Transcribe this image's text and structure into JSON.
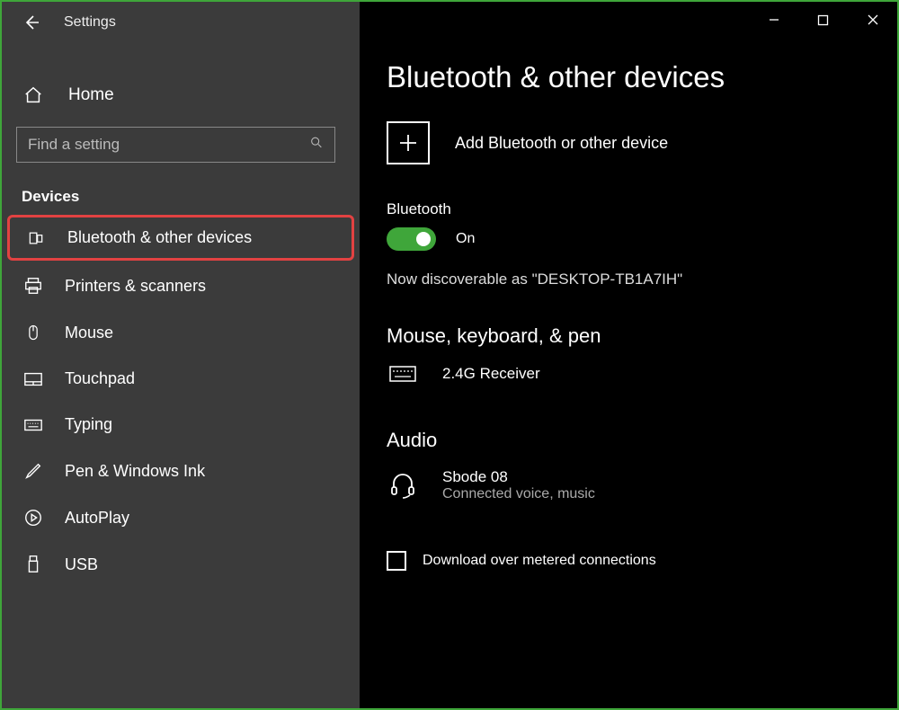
{
  "titlebar": {
    "label": "Settings"
  },
  "home": {
    "label": "Home"
  },
  "search": {
    "placeholder": "Find a setting"
  },
  "section_label": "Devices",
  "sidebar": {
    "items": [
      {
        "label": "Bluetooth & other devices"
      },
      {
        "label": "Printers & scanners"
      },
      {
        "label": "Mouse"
      },
      {
        "label": "Touchpad"
      },
      {
        "label": "Typing"
      },
      {
        "label": "Pen & Windows Ink"
      },
      {
        "label": "AutoPlay"
      },
      {
        "label": "USB"
      }
    ]
  },
  "main": {
    "title": "Bluetooth & other devices",
    "add_label": "Add Bluetooth or other device",
    "bt_label": "Bluetooth",
    "bt_state": "On",
    "discoverable_text": "Now discoverable as \"DESKTOP-TB1A7IH\"",
    "group1_title": "Mouse, keyboard, & pen",
    "device1_label": "2.4G Receiver",
    "group2_title": "Audio",
    "device2_label": "Sbode 08",
    "device2_sub": "Connected voice, music",
    "metered_label": "Download over metered connections"
  }
}
